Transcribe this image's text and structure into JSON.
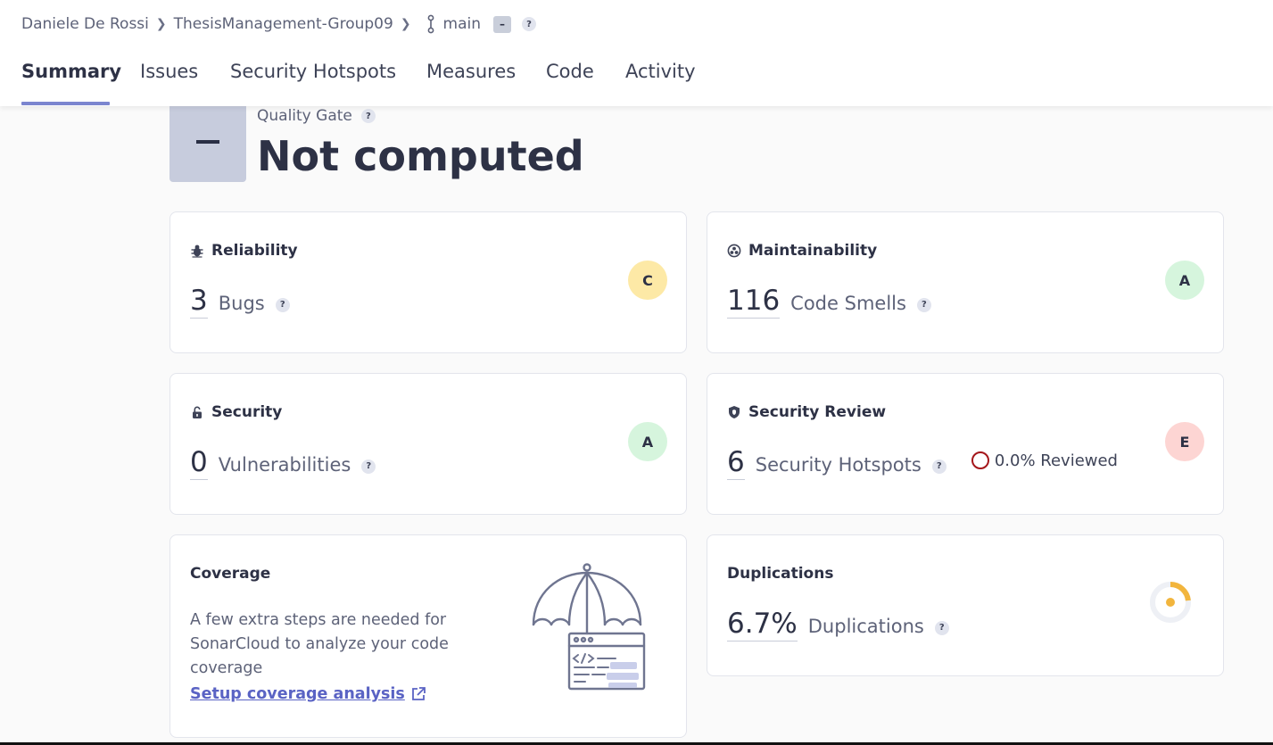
{
  "breadcrumb": {
    "owner": "Daniele De Rossi",
    "project": "ThesisManagement-Group09",
    "branch": "main",
    "branch_badge": "–",
    "help": "?"
  },
  "tabs": [
    {
      "label": "Summary",
      "active": true
    },
    {
      "label": "Issues"
    },
    {
      "label": "Security Hotspots"
    },
    {
      "label": "Measures"
    },
    {
      "label": "Code"
    },
    {
      "label": "Activity"
    }
  ],
  "quality_gate": {
    "label": "Quality Gate",
    "status": "Not computed",
    "help": "?"
  },
  "cards": {
    "reliability": {
      "title": "Reliability",
      "value": "3",
      "unit": "Bugs",
      "rating": "C",
      "rating_color": "#fde9a6",
      "help": "?"
    },
    "maintainability": {
      "title": "Maintainability",
      "value": "116",
      "unit": "Code Smells",
      "rating": "A",
      "rating_color": "#d6f5dd",
      "help": "?"
    },
    "security": {
      "title": "Security",
      "value": "0",
      "unit": "Vulnerabilities",
      "rating": "A",
      "rating_color": "#d6f5dd",
      "help": "?"
    },
    "security_review": {
      "title": "Security Review",
      "value": "6",
      "unit": "Security Hotspots",
      "reviewed": "0.0% Reviewed",
      "rating": "E",
      "rating_color": "#fdd5d3",
      "help": "?"
    },
    "coverage": {
      "title": "Coverage",
      "text": "A few extra steps are needed for SonarCloud to analyze your code coverage",
      "link": "Setup coverage analysis"
    },
    "duplications": {
      "title": "Duplications",
      "value": "6.7%",
      "unit": "Duplications",
      "help": "?",
      "donut_fraction": 0.067,
      "donut_color": "#f2b53d"
    }
  }
}
